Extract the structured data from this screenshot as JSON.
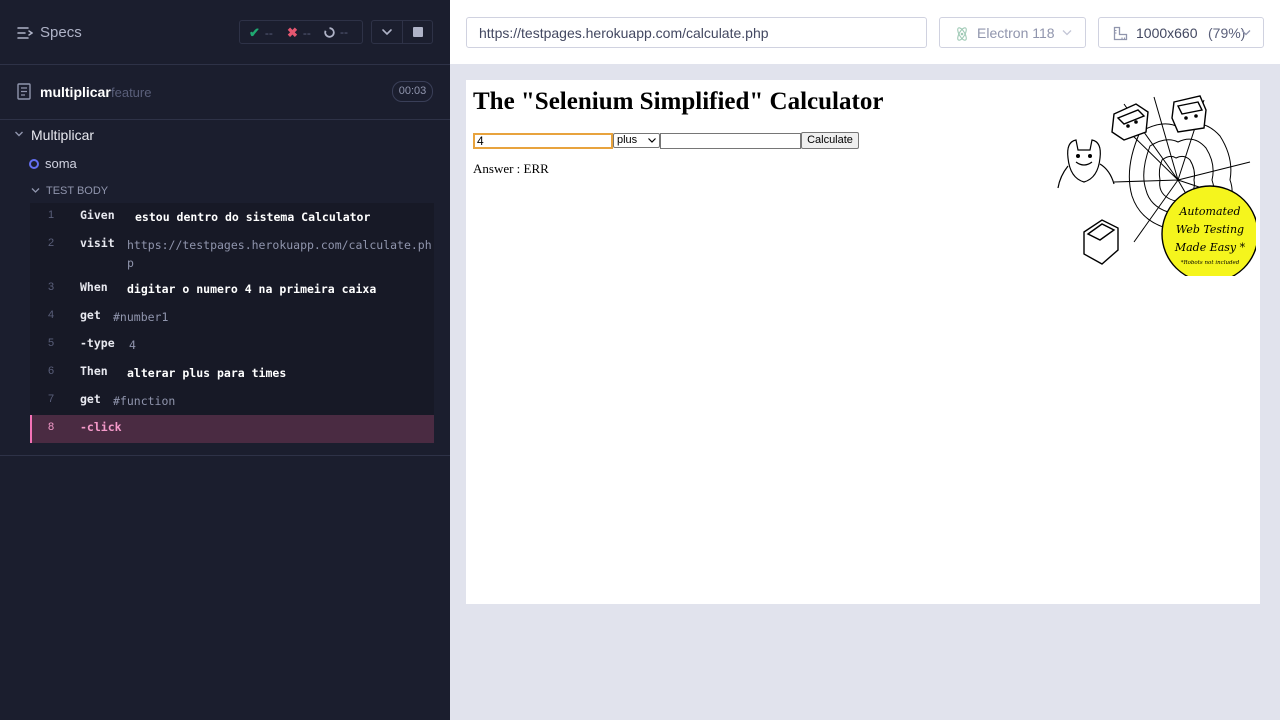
{
  "reporter": {
    "specs_label": "Specs",
    "stats": {
      "passed": "--",
      "failed": "--",
      "pending": "--"
    },
    "file": {
      "name": "multiplicar",
      "ext": "feature",
      "duration": "00:03"
    },
    "suite": {
      "title": "Multiplicar"
    },
    "test": {
      "title": "soma"
    },
    "body_label": "TEST BODY",
    "commands": [
      {
        "num": "1",
        "kw": "Given",
        "msg": "estou dentro do sistema Calculator",
        "bold": true
      },
      {
        "num": "2",
        "kw": "visit",
        "msg": "https://testpages.herokuapp.com/calculate.php",
        "bold": false
      },
      {
        "num": "3",
        "kw": "When",
        "msg": "digitar o numero 4 na primeira caixa",
        "bold": true
      },
      {
        "num": "4",
        "kw": "get",
        "msg": "#number1",
        "bold": false
      },
      {
        "num": "5",
        "kw": "-type",
        "msg": "4",
        "bold": false
      },
      {
        "num": "6",
        "kw": "Then",
        "msg": "alterar plus para times",
        "bold": true
      },
      {
        "num": "7",
        "kw": "get",
        "msg": "#function",
        "bold": false
      },
      {
        "num": "8",
        "kw": "-click",
        "msg": "",
        "bold": false,
        "active": true
      }
    ]
  },
  "header": {
    "url": "https://testpages.herokuapp.com/calculate.php",
    "browser": "Electron 118",
    "viewport_size": "1000x660",
    "viewport_scale": "(79%)"
  },
  "aut": {
    "title": "The \"Selenium Simplified\" Calculator",
    "number1_value": "4",
    "function_value": "plus",
    "number2_value": "",
    "calculate_label": "Calculate",
    "answer": "Answer : ERR",
    "logo_text": [
      "Automated",
      "Web Testing",
      "Made Easy *",
      "*Robots not included"
    ]
  },
  "colors": {
    "reporter_bg": "#1b1e2e",
    "passed": "#1fa971",
    "failed": "#e45770",
    "pending": "#afb3c7",
    "active_command": "#4a2b42",
    "active_accent": "#f472b6",
    "logo_yellow": "#f5f51d"
  }
}
